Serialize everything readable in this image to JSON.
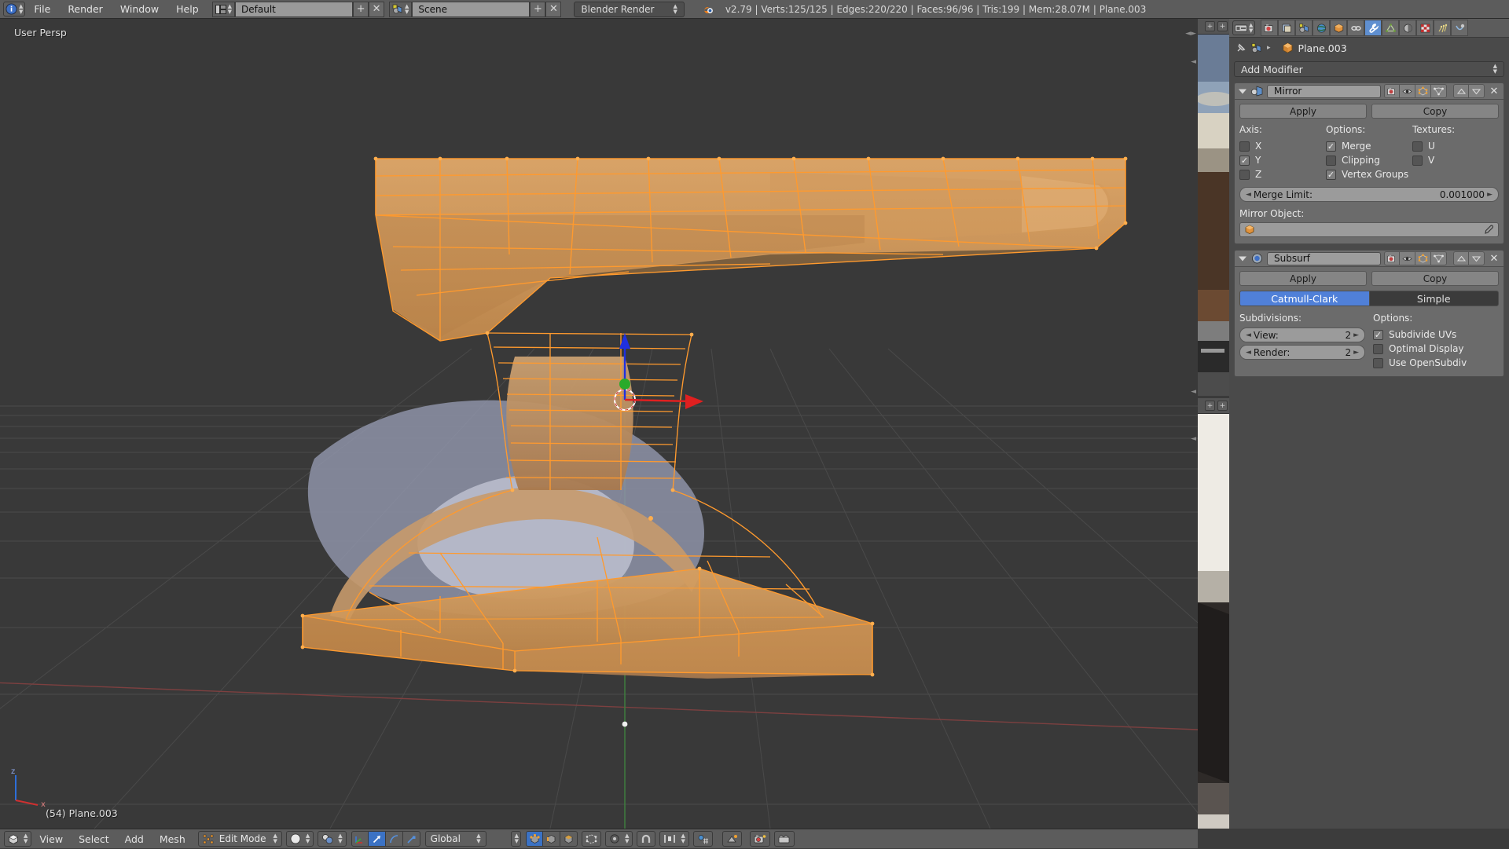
{
  "app": {
    "version_stats": "v2.79 | Verts:125/125 | Edges:220/220 | Faces:96/96 | Tris:199 | Mem:28.07M | Plane.003",
    "accent_blue": "#5080d8",
    "header_bg": "#5c5c5c",
    "viewport_bg": "#393939",
    "mesh_orange": "#ff9a2e"
  },
  "topbar": {
    "editor_icon": "info-editor-icon",
    "menus": [
      "File",
      "Render",
      "Window",
      "Help"
    ],
    "screen_layout": {
      "icon": "screen-layout-icon",
      "value": "Default",
      "add_label": "+",
      "delete_label": "✕"
    },
    "scene": {
      "icon": "scene-icon",
      "value": "Scene",
      "add_label": "+",
      "delete_label": "✕"
    },
    "render_engine": {
      "value": "Blender Render"
    },
    "blender_icon": "blender-logo-icon"
  },
  "viewport": {
    "perspective_label": "User Persp",
    "object_label": "(54) Plane.003",
    "manipulator": {
      "x_axis_color": "#e02020",
      "y_axis_color": "#2aaa2a",
      "z_axis_color": "#2030e0"
    },
    "axis_gizmo": {
      "x_label": "x",
      "z_label": "z"
    }
  },
  "viewport_header": {
    "editor_icon": "3dview-editor-icon",
    "menus": [
      "View",
      "Select",
      "Add",
      "Mesh"
    ],
    "mode": {
      "icon": "edit-mode-icon",
      "value": "Edit Mode"
    },
    "shading": {
      "icon": "solid-shading-icon"
    },
    "pivot": {
      "icon": "pivot-median-icon"
    },
    "manipulator_buttons": [
      {
        "name": "manipulator-toggle-icon",
        "active": false
      },
      {
        "name": "translate-manipulator-icon",
        "active": true
      },
      {
        "name": "rotate-manipulator-icon",
        "active": false
      },
      {
        "name": "scale-manipulator-icon",
        "active": false
      }
    ],
    "orientation": {
      "value": "Global"
    },
    "select_modes": [
      {
        "name": "vertex-select-icon",
        "active": true
      },
      {
        "name": "edge-select-icon",
        "active": false
      },
      {
        "name": "face-select-icon",
        "active": false
      }
    ],
    "occlude_icon": "occlude-geometry-icon",
    "proportional_icon": "proportional-edit-icon",
    "falloff_icon": "proportional-falloff-icon",
    "snap_icon": "snap-magnet-icon",
    "snap_target_icon": "snap-target-icon",
    "snap_element_icon": "snap-element-icon",
    "visibility_icon": "layer-visibility-icon",
    "render_icon": "render-image-icon",
    "render_anim_icon": "render-animation-icon"
  },
  "image_strip": {
    "add_label": "+",
    "panels": [
      {
        "name": "reference-photo-top"
      },
      {
        "name": "reference-photo-bottom"
      }
    ]
  },
  "properties": {
    "tabs": [
      {
        "name": "render-tab",
        "icon": "camera-back-icon",
        "active": false
      },
      {
        "name": "render-layers-tab",
        "icon": "render-layers-icon",
        "active": false
      },
      {
        "name": "scene-tab",
        "icon": "scene-icon",
        "active": false
      },
      {
        "name": "world-tab",
        "icon": "world-icon",
        "active": false
      },
      {
        "name": "object-tab",
        "icon": "object-cube-icon",
        "active": false
      },
      {
        "name": "constraints-tab",
        "icon": "chain-link-icon",
        "active": false
      },
      {
        "name": "modifiers-tab",
        "icon": "wrench-icon",
        "active": true
      },
      {
        "name": "data-tab",
        "icon": "mesh-data-icon",
        "active": false
      },
      {
        "name": "material-tab",
        "icon": "material-sphere-icon",
        "active": false
      },
      {
        "name": "texture-tab",
        "icon": "texture-checker-icon",
        "active": false
      },
      {
        "name": "particles-tab",
        "icon": "particles-icon",
        "active": false
      },
      {
        "name": "physics-tab",
        "icon": "physics-icon",
        "active": false
      }
    ],
    "breadcrumb": {
      "pin_icon": "pin-icon",
      "scene_icon": "scene-icon",
      "separator": "▸",
      "object_icon": "object-cube-icon",
      "object_name": "Plane.003"
    },
    "add_modifier": {
      "label": "Add Modifier"
    },
    "modifiers": [
      {
        "expand_icon": "collapse-triangle-icon",
        "type_icon": "mirror-modifier-icon",
        "name": "Mirror",
        "display_toggles": [
          {
            "name": "render-visibility-icon"
          },
          {
            "name": "viewport-visibility-icon"
          },
          {
            "name": "edit-mode-display-icon"
          },
          {
            "name": "on-cage-display-icon"
          }
        ],
        "move_up_label": "▲",
        "move_down_label": "▼",
        "close_label": "✕",
        "apply_label": "Apply",
        "copy_label": "Copy",
        "columns": [
          {
            "header": "Axis:",
            "items": [
              {
                "label": "X",
                "checked": false
              },
              {
                "label": "Y",
                "checked": true
              },
              {
                "label": "Z",
                "checked": false
              }
            ]
          },
          {
            "header": "Options:",
            "items": [
              {
                "label": "Merge",
                "checked": true
              },
              {
                "label": "Clipping",
                "checked": false
              },
              {
                "label": "Vertex Groups",
                "checked": true
              }
            ]
          },
          {
            "header": "Textures:",
            "items": [
              {
                "label": "U",
                "checked": false
              },
              {
                "label": "V",
                "checked": false
              }
            ]
          }
        ],
        "merge_limit": {
          "label": "Merge Limit:",
          "value": "0.001000"
        },
        "mirror_object": {
          "label": "Mirror Object:",
          "value": "",
          "icon": "object-cube-icon",
          "eyedropper_icon": "eyedropper-icon"
        }
      },
      {
        "expand_icon": "collapse-triangle-icon",
        "type_icon": "subsurf-modifier-icon",
        "name": "Subsurf",
        "display_toggles": [
          {
            "name": "render-visibility-icon"
          },
          {
            "name": "viewport-visibility-icon"
          },
          {
            "name": "edit-mode-display-icon"
          },
          {
            "name": "on-cage-display-icon"
          }
        ],
        "move_up_label": "▲",
        "move_down_label": "▼",
        "close_label": "✕",
        "apply_label": "Apply",
        "copy_label": "Copy",
        "subdivision_types": [
          {
            "label": "Catmull-Clark",
            "selected": true
          },
          {
            "label": "Simple",
            "selected": false
          }
        ],
        "subdivisions_header": "Subdivisions:",
        "options_header": "Options:",
        "subdivisions": [
          {
            "label": "View:",
            "value": "2"
          },
          {
            "label": "Render:",
            "value": "2"
          }
        ],
        "options": [
          {
            "label": "Subdivide UVs",
            "checked": true
          },
          {
            "label": "Optimal Display",
            "checked": false
          },
          {
            "label": "Use OpenSubdiv",
            "checked": false
          }
        ]
      }
    ]
  }
}
